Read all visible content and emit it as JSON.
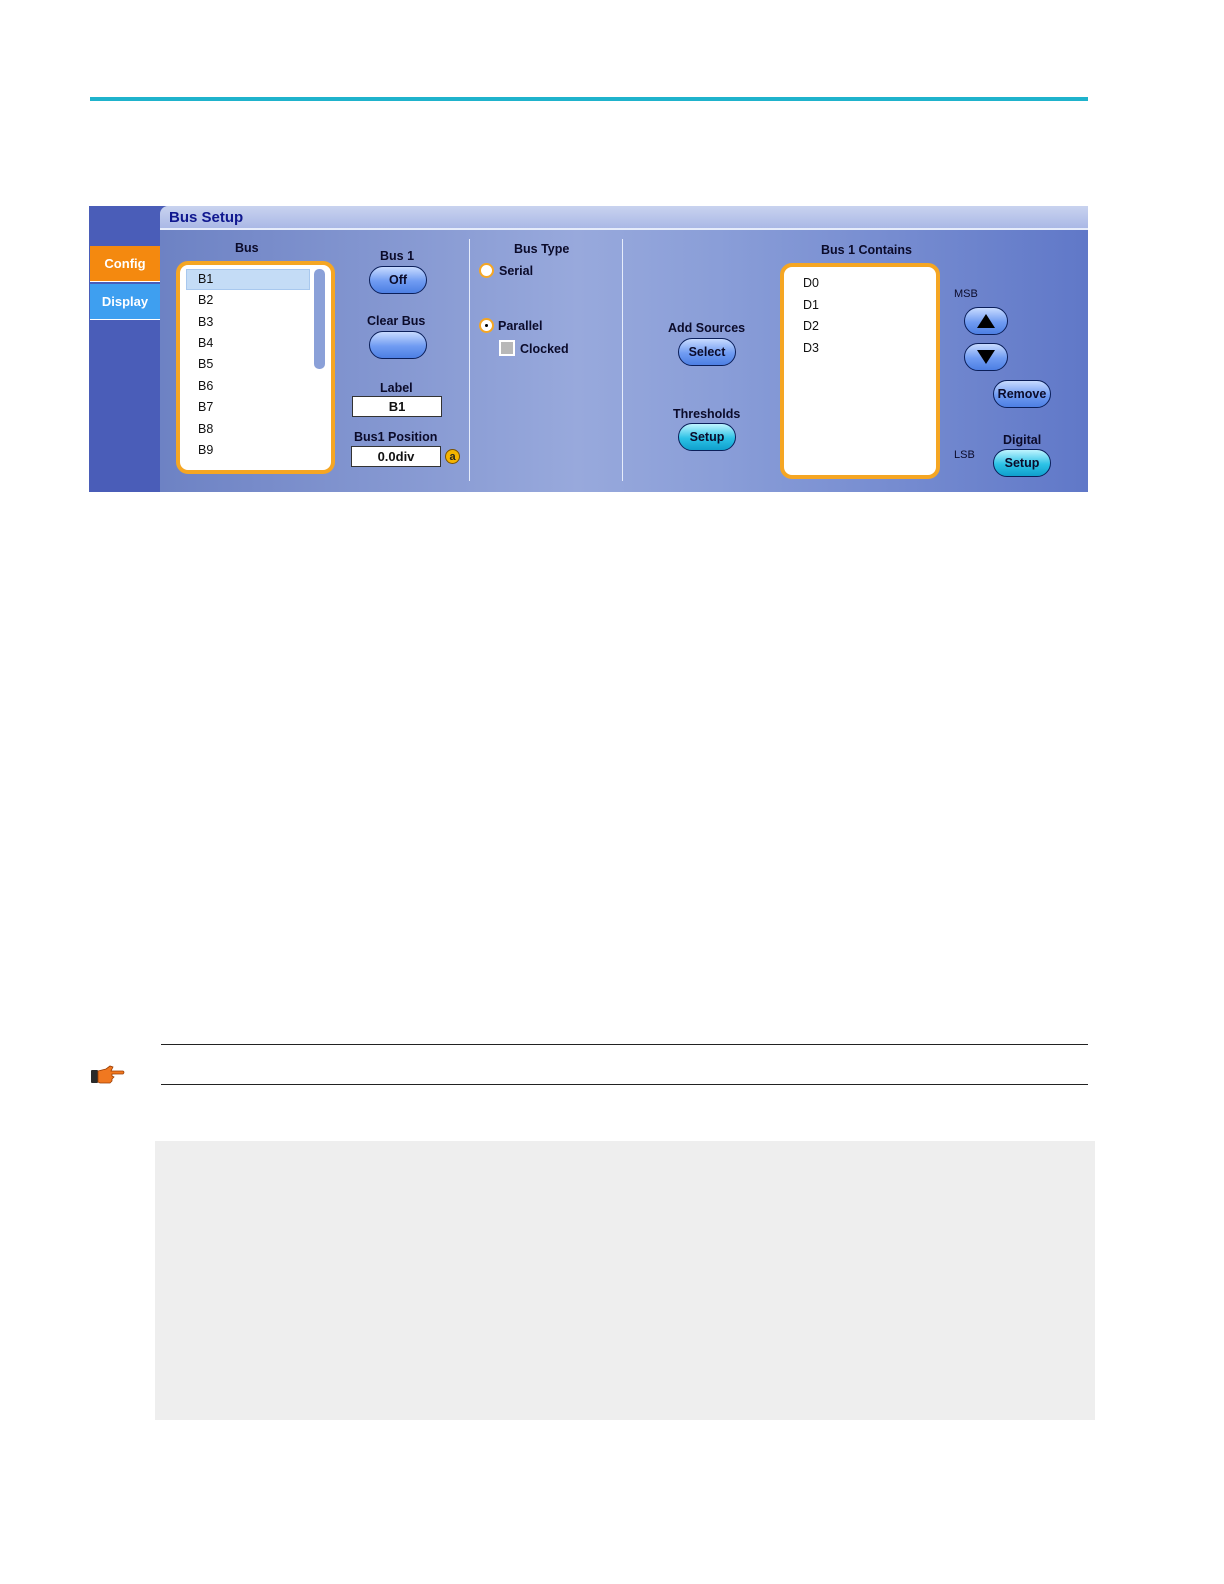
{
  "panel": {
    "title": "Bus Setup",
    "tabs": [
      {
        "label": "Config",
        "active": true
      },
      {
        "label": "Display",
        "active": false
      }
    ],
    "bus_list": {
      "header": "Bus",
      "items": [
        "B1",
        "B2",
        "B3",
        "B4",
        "B5",
        "B6",
        "B7",
        "B8",
        "B9"
      ],
      "selected": "B1"
    },
    "bus1": {
      "label": "Bus 1",
      "toggle_value": "Off"
    },
    "clear_bus": {
      "label": "Clear Bus"
    },
    "label_field": {
      "label": "Label",
      "value": "B1"
    },
    "position_field": {
      "label": "Bus1 Position",
      "value": "0.0div",
      "badge": "a"
    },
    "bus_type": {
      "header": "Bus Type",
      "serial_label": "Serial",
      "parallel_label": "Parallel",
      "selected": "Parallel",
      "clocked_label": "Clocked",
      "clocked_checked": false
    },
    "add_sources": {
      "label": "Add Sources",
      "button": "Select"
    },
    "thresholds": {
      "label": "Thresholds",
      "button": "Setup"
    },
    "contains": {
      "header": "Bus 1 Contains",
      "items": [
        "D0",
        "D1",
        "D2",
        "D3"
      ]
    },
    "msb_label": "MSB",
    "lsb_label": "LSB",
    "remove_label": "Remove",
    "digital": {
      "label": "Digital",
      "button": "Setup"
    }
  },
  "colors": {
    "accent_rule": "#1fb3cc",
    "tab_config": "#f4890f",
    "tab_display": "#3e9ff0",
    "listbox_border": "#f5a623",
    "title_text": "#10188f"
  }
}
